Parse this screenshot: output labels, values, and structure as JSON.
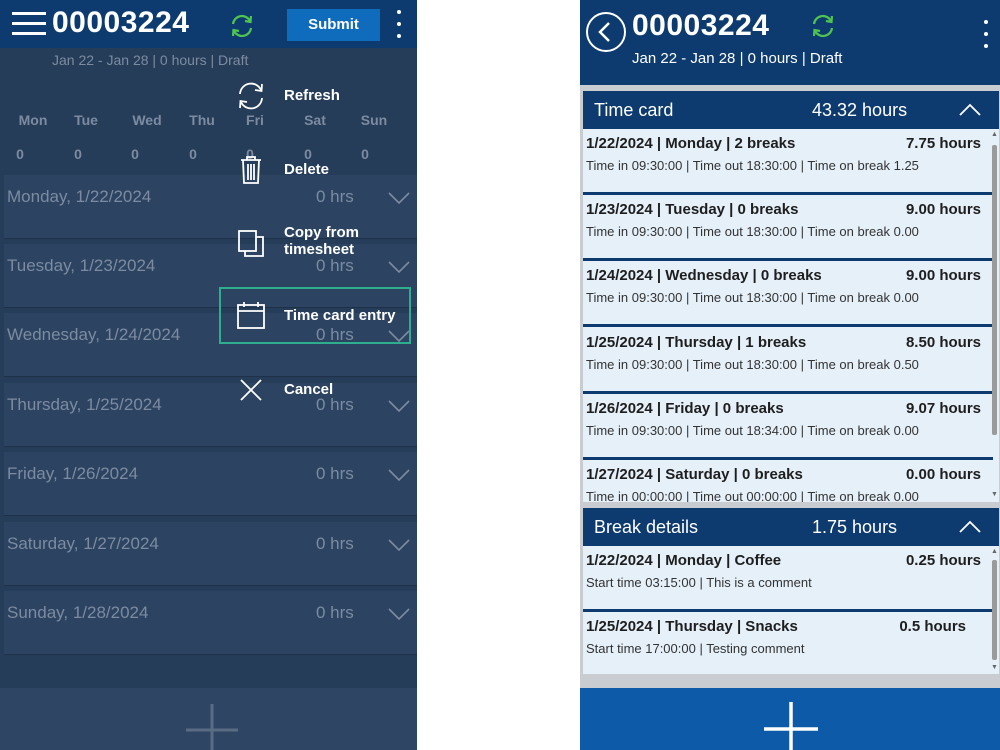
{
  "left": {
    "title": "00003224",
    "subtitle": "Jan 22 - Jan 28 | 0 hours | Draft",
    "submit_label": "Submit",
    "days": [
      {
        "label": "Mon",
        "value": "0"
      },
      {
        "label": "Tue",
        "value": "0"
      },
      {
        "label": "Wed",
        "value": "0"
      },
      {
        "label": "Thu",
        "value": "0"
      },
      {
        "label": "Fri",
        "value": "0"
      },
      {
        "label": "Sat",
        "value": "0"
      },
      {
        "label": "Sun",
        "value": "0"
      }
    ],
    "rows": [
      {
        "date": "Monday, 1/22/2024",
        "hours": "0 hrs"
      },
      {
        "date": "Tuesday, 1/23/2024",
        "hours": "0 hrs"
      },
      {
        "date": "Wednesday, 1/24/2024",
        "hours": "0 hrs"
      },
      {
        "date": "Thursday, 1/25/2024",
        "hours": "0 hrs"
      },
      {
        "date": "Friday, 1/26/2024",
        "hours": "0 hrs"
      },
      {
        "date": "Saturday, 1/27/2024",
        "hours": "0 hrs"
      },
      {
        "date": "Sunday, 1/28/2024",
        "hours": "0 hrs"
      }
    ],
    "menu": {
      "refresh": "Refresh",
      "delete": "Delete",
      "copy_line1": "Copy from",
      "copy_line2": "timesheet",
      "time_card_entry": "Time card entry",
      "cancel": "Cancel"
    }
  },
  "right": {
    "title": "00003224",
    "subtitle": "Jan 22 - Jan 28 | 0 hours | Draft",
    "time_card": {
      "title": "Time card",
      "total": "43.32 hours",
      "entries": [
        {
          "line1": "1/22/2024 | Monday | 2 breaks",
          "hours": "7.75 hours",
          "line2": "Time in 09:30:00 | Time out 18:30:00 | Time on break 1.25"
        },
        {
          "line1": "1/23/2024 | Tuesday | 0 breaks",
          "hours": "9.00 hours",
          "line2": "Time in 09:30:00 | Time out 18:30:00 | Time on break 0.00"
        },
        {
          "line1": "1/24/2024 | Wednesday | 0 breaks",
          "hours": "9.00 hours",
          "line2": "Time in 09:30:00 | Time out 18:30:00 | Time on break 0.00"
        },
        {
          "line1": "1/25/2024 | Thursday | 1 breaks",
          "hours": "8.50 hours",
          "line2": "Time in 09:30:00 | Time out 18:30:00 | Time on break 0.50"
        },
        {
          "line1": "1/26/2024 | Friday | 0 breaks",
          "hours": "9.07 hours",
          "line2": "Time in 09:30:00 | Time out 18:34:00 | Time on break 0.00"
        },
        {
          "line1": "1/27/2024 | Saturday | 0 breaks",
          "hours": "0.00 hours",
          "line2": "Time in 00:00:00 | Time out 00:00:00 | Time on break 0.00"
        }
      ]
    },
    "break_details": {
      "title": "Break details",
      "total": "1.75 hours",
      "entries": [
        {
          "line1": "1/22/2024 | Monday | Coffee",
          "hours": "0.25 hours",
          "line2": "Start time 03:15:00 | This is a comment"
        },
        {
          "line1": "1/25/2024 | Thursday | Snacks",
          "hours": "0.5 hours",
          "line2": "Start time 17:00:00 | Testing comment"
        }
      ]
    }
  },
  "colors": {
    "header_navy": "#0d3b6f",
    "submit_blue": "#0f6cbd",
    "sync_green": "#4fc54f",
    "selected_outline": "#2fae8f",
    "list_bg": "#e6f0f9",
    "footer_blue": "#0d5ba8"
  },
  "icons": [
    "hamburger-icon",
    "sync-icon",
    "more-icon",
    "refresh-icon",
    "delete-icon",
    "copy-icon",
    "calendar-icon",
    "close-icon",
    "chevron-down-icon",
    "chevron-up-icon",
    "back-icon",
    "add-icon"
  ]
}
